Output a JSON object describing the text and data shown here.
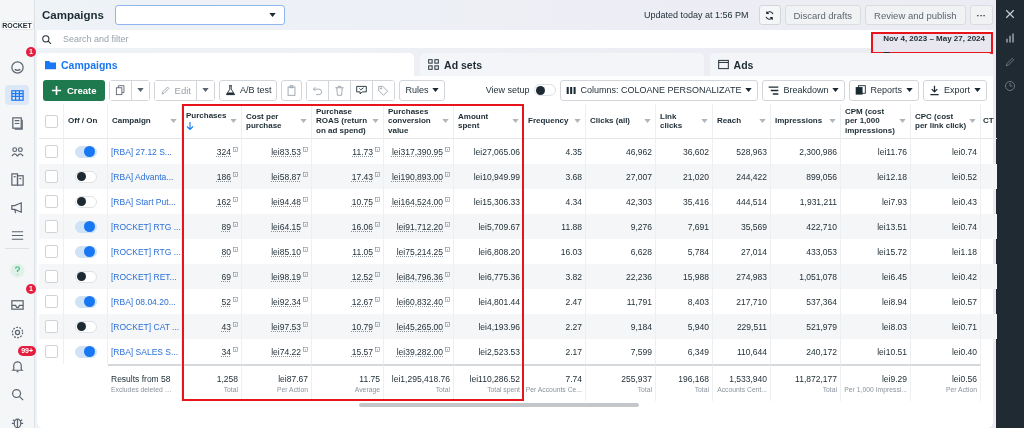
{
  "header": {
    "title": "Campaigns",
    "updated": "Updated today at 1:56 PM",
    "discard": "Discard drafts",
    "publish": "Review and publish",
    "more": "···",
    "search_placeholder": "Search and filter",
    "date_range": "Nov 4, 2023 – May 27, 2024",
    "date_highlighted": true
  },
  "sidebar": {
    "account_logo": "ROCKET",
    "top_items": [
      {
        "selected": false,
        "badge": "1"
      },
      {
        "selected": true
      },
      {
        "selected": false
      },
      {
        "selected": false
      },
      {
        "selected": false
      },
      {
        "selected": false
      },
      {
        "selected": false
      }
    ],
    "bottom_items": [
      {
        "selected": false
      },
      {
        "selected": false,
        "badge": "1"
      },
      {
        "selected": false
      },
      {
        "selected": false,
        "badge": "99+"
      },
      {
        "selected": false
      },
      {
        "selected": false
      }
    ]
  },
  "tabs": [
    {
      "label": "Campaigns",
      "selected": true
    },
    {
      "label": "Ad sets",
      "selected": false
    },
    {
      "label": "Ads",
      "selected": false
    }
  ],
  "toolbar": {
    "create": "Create",
    "edit": "Edit",
    "ab_test": "A/B test",
    "rules": "Rules",
    "view_setup": "View setup",
    "view_setup_on": false,
    "columns": "Columns: COLOANE PERSONALIZATE",
    "breakdown": "Breakdown",
    "reports": "Reports",
    "export": "Export"
  },
  "table": {
    "all_selected": false,
    "toggle_header": "Off / On",
    "name_header": "Campaign",
    "columns": [
      {
        "label": "Purchases",
        "kind": "attributed",
        "sorted": true,
        "highlighted": true
      },
      {
        "label": "Cost per purchase",
        "kind": "attributed",
        "sorted": false,
        "highlighted": true
      },
      {
        "label": "Purchase ROAS (return on ad spend)",
        "kind": "attributed",
        "sorted": false,
        "highlighted": true
      },
      {
        "label": "Purchases conversion value",
        "kind": "attributed",
        "sorted": false,
        "highlighted": true
      },
      {
        "label": "Amount spent",
        "kind": "plain",
        "sorted": false,
        "highlighted": true
      },
      {
        "label": "Frequency",
        "kind": "plain",
        "sorted": false,
        "highlighted": false
      },
      {
        "label": "Clicks (all)",
        "kind": "plain",
        "sorted": false,
        "highlighted": false
      },
      {
        "label": "Link clicks",
        "kind": "plain",
        "sorted": false,
        "highlighted": false
      },
      {
        "label": "Reach",
        "kind": "plain",
        "sorted": false,
        "highlighted": false
      },
      {
        "label": "Impressions",
        "kind": "plain",
        "sorted": false,
        "highlighted": false
      },
      {
        "label": "CPM (cost per 1,000 impressions)",
        "kind": "plain",
        "sorted": false,
        "highlighted": false
      },
      {
        "label": "CPC (cost per link click)",
        "kind": "plain",
        "sorted": false,
        "highlighted": false
      }
    ],
    "cut_column_label": "CT",
    "rows": [
      {
        "selected": false,
        "on": true,
        "name": "[RBA] 27.12 S...",
        "cells": [
          "324",
          "lei83.53",
          "11.73",
          "lei317,390.95",
          "lei27,065.06",
          "4.35",
          "46,962",
          "36,602",
          "528,963",
          "2,300,986",
          "lei11.76",
          "lei0.74"
        ]
      },
      {
        "selected": false,
        "on": false,
        "name": "[RBA] Advanta...",
        "cells": [
          "186",
          "lei58.87",
          "17.43",
          "lei190,893.00",
          "lei10,949.99",
          "3.68",
          "27,007",
          "21,020",
          "244,422",
          "899,056",
          "lei12.18",
          "lei0.52"
        ]
      },
      {
        "selected": false,
        "on": false,
        "name": "[RBA] Start Put...",
        "cells": [
          "162",
          "lei94.48",
          "10.75",
          "lei164,524.00",
          "lei15,306.33",
          "4.34",
          "42,303",
          "35,416",
          "444,514",
          "1,931,211",
          "lei7.93",
          "lei0.43"
        ]
      },
      {
        "selected": false,
        "on": true,
        "name": "[ROCKET] RTG ...",
        "cells": [
          "89",
          "lei64.15",
          "16.06",
          "lei91,712.20",
          "lei5,709.67",
          "11.88",
          "9,276",
          "7,691",
          "35,569",
          "422,710",
          "lei13.51",
          "lei0.74"
        ]
      },
      {
        "selected": false,
        "on": true,
        "name": "[ROCKET] RTG ...",
        "cells": [
          "80",
          "lei85.10",
          "11.05",
          "lei75,214.25",
          "lei6,808.20",
          "16.03",
          "6,628",
          "5,784",
          "27,014",
          "433,053",
          "lei15.72",
          "lei1.18"
        ]
      },
      {
        "selected": false,
        "on": false,
        "name": "[ROCKET] RET...",
        "cells": [
          "69",
          "lei98.19",
          "12.52",
          "lei84,796.36",
          "lei6,775.36",
          "3.82",
          "22,236",
          "15,988",
          "274,983",
          "1,051,078",
          "lei6.45",
          "lei0.42"
        ]
      },
      {
        "selected": false,
        "on": true,
        "name": "[RBA] 08.04.20...",
        "cells": [
          "52",
          "lei92.34",
          "12.67",
          "lei60,832.40",
          "lei4,801.44",
          "2.47",
          "11,791",
          "8,403",
          "217,710",
          "537,364",
          "lei8.94",
          "lei0.57"
        ]
      },
      {
        "selected": false,
        "on": false,
        "name": "[ROCKET] CAT ...",
        "cells": [
          "43",
          "lei97.53",
          "10.79",
          "lei45,265.00",
          "lei4,193.96",
          "2.27",
          "9,184",
          "5,940",
          "229,511",
          "521,979",
          "lei8.03",
          "lei0.71"
        ]
      },
      {
        "selected": false,
        "on": true,
        "name": "[RBA] SALES S...",
        "cells": [
          "34",
          "lei74.22",
          "15.57",
          "lei39,282.00",
          "lei2,523.53",
          "2.17",
          "7,599",
          "6,349",
          "110,644",
          "240,172",
          "lei10.51",
          "lei0.40"
        ]
      }
    ],
    "footer": {
      "label": "Results from 58",
      "note": "Excludes deleted …",
      "cells": [
        {
          "value": "1,258",
          "note": "Total"
        },
        {
          "value": "lei87.67",
          "note": "Per Action"
        },
        {
          "value": "11.75",
          "note": "Average"
        },
        {
          "value": "lei1,295,418.76",
          "note": "Total"
        },
        {
          "value": "lei110,286.52",
          "note": "Total spent"
        },
        {
          "value": "7.74",
          "note": "Per Accounts Ce..."
        },
        {
          "value": "255,937",
          "note": "Total"
        },
        {
          "value": "196,168",
          "note": "Total"
        },
        {
          "value": "1,533,940",
          "note": "Accounts Cent..."
        },
        {
          "value": "11,872,177",
          "note": "Total"
        },
        {
          "value": "lei9.29",
          "note": "Per 1,000 Impressi..."
        },
        {
          "value": "lei0.56",
          "note": "Per Action"
        }
      ]
    }
  }
}
